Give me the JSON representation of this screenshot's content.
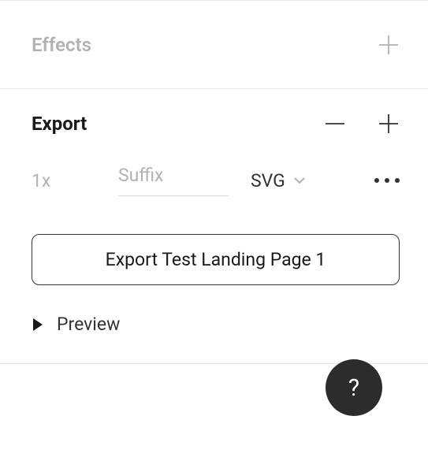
{
  "effects": {
    "title": "Effects"
  },
  "export": {
    "title": "Export",
    "scale": "1x",
    "suffix_placeholder": "Suffix",
    "suffix_value": "",
    "format": "SVG",
    "button_label": "Export Test Landing Page 1",
    "preview_label": "Preview"
  },
  "help": {
    "label": "?"
  }
}
